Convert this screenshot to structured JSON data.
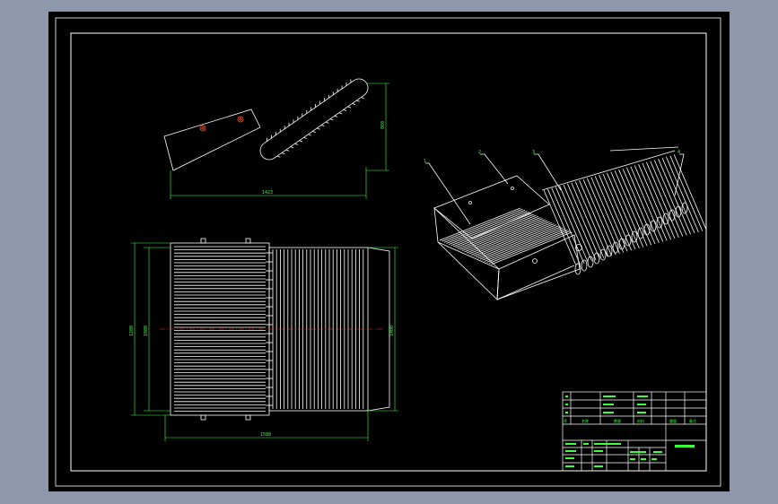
{
  "drawing": {
    "side_view": {
      "dim_length": "1423",
      "dim_height": "860"
    },
    "top_view": {
      "dim_width": "1588",
      "dim_height_left": "1280",
      "dim_height_inner": "1080",
      "dim_height_right": "1400"
    },
    "iso_view": {
      "balloons": [
        "1",
        "2",
        "3",
        "4"
      ]
    },
    "title_block": {
      "rows": [
        [
          "",
          "",
          "",
          "",
          "",
          ""
        ],
        [
          "",
          "",
          "",
          "",
          "",
          ""
        ],
        [
          "",
          "",
          "",
          "",
          "",
          ""
        ],
        [
          "",
          "",
          "",
          "",
          "",
          ""
        ]
      ],
      "header_cells": [
        "序",
        "名称",
        "数量",
        "材料",
        "重量",
        "备注"
      ],
      "info_cells": [
        "",
        "",
        "",
        "",
        "",
        "",
        ""
      ],
      "drawing_name": "",
      "sheet_cells": [
        "",
        "",
        "",
        ""
      ]
    }
  },
  "colors": {
    "background": "#8d98ab",
    "paper": "#000000",
    "line": "#ffffff",
    "dimension": "#3cff3c",
    "centerline": "#ff3030",
    "hole": "#ff5a2a"
  }
}
